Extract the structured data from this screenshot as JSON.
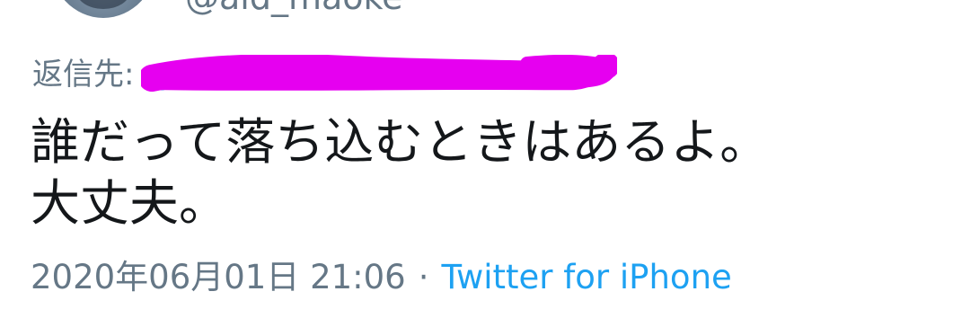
{
  "author": {
    "handle": "@aid_maoke"
  },
  "reply": {
    "label": "返信先:",
    "target": "@"
  },
  "tweet": {
    "lines": [
      "誰だって落ち込むときはあるよ。",
      "大丈夫。"
    ]
  },
  "meta": {
    "timestamp": "2020年06月01日 21:06",
    "separator": "·",
    "source": "Twitter for iPhone"
  },
  "colors": {
    "text": "#14171a",
    "secondary": "#657786",
    "link": "#1da1f2",
    "redaction": "#e600f0"
  }
}
